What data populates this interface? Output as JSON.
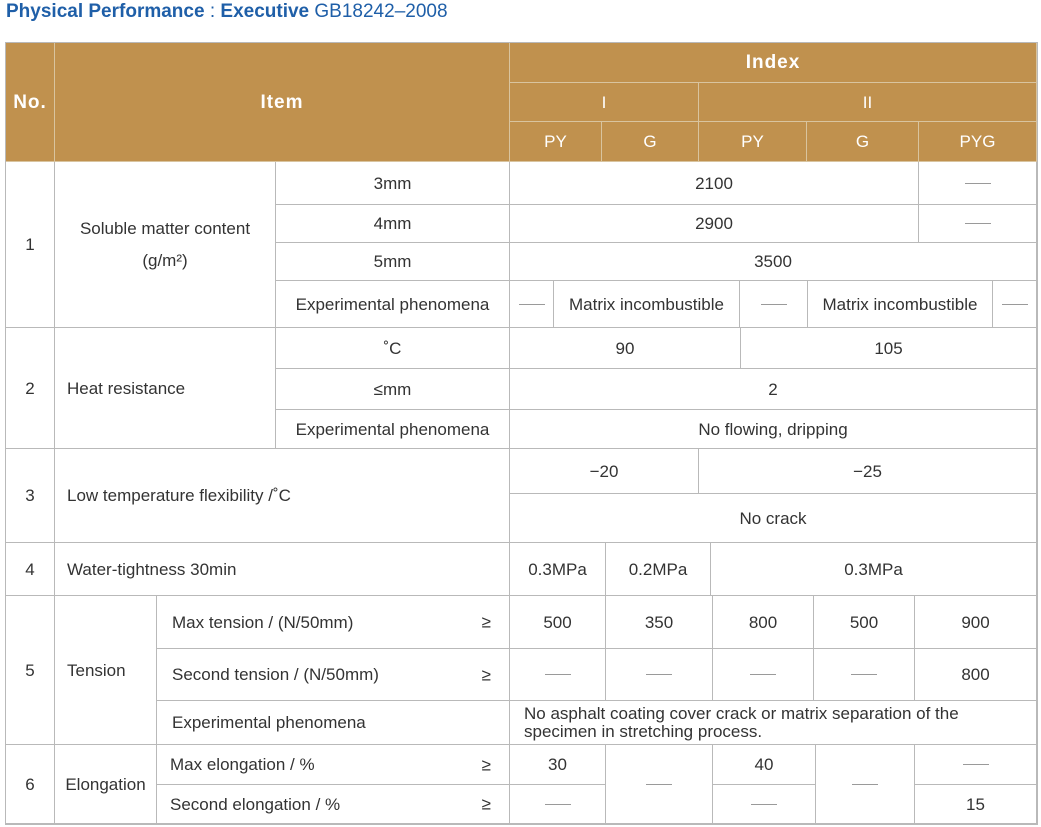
{
  "title": {
    "prefix": "Physical Performance",
    "sep": " : ",
    "executive": "Executive",
    "standard": " GB18242–2008"
  },
  "header": {
    "no": "No.",
    "item": "Item",
    "index": "Index",
    "grade_1": "I",
    "grade_2": "II",
    "py": "PY",
    "g": "G",
    "pyg": "PYG"
  },
  "rows": {
    "r1": {
      "no": "1",
      "item_line1": "Soluble matter content",
      "item_unit": "(g/m²)",
      "sub_3mm": "3mm",
      "sub_4mm": "4mm",
      "sub_5mm": "5mm",
      "sub_phen": "Experimental phenomena",
      "v_3mm": "2100",
      "v_4mm": "2900",
      "v_5mm": "3500",
      "phen_1": "Matrix incombustible",
      "phen_2": "Matrix incombustible"
    },
    "r2": {
      "no": "2",
      "item": "Heat resistance",
      "sub_c": "˚C",
      "sub_mm": "≤mm",
      "sub_phen": "Experimental phenomena",
      "v_c_1": "90",
      "v_c_2": "105",
      "v_mm": "2",
      "v_phen": "No flowing, dripping"
    },
    "r3": {
      "no": "3",
      "item": "Low temperature flexibility /˚C",
      "v_1": "−20",
      "v_2": "−25",
      "v_crack": "No crack"
    },
    "r4": {
      "no": "4",
      "item": "Water-tightness  30min",
      "v_1": "0.3MPa",
      "v_2": "0.2MPa",
      "v_3": "0.3MPa"
    },
    "r5": {
      "no": "5",
      "item": "Tension",
      "sub_max": "Max tension / (N/50mm)",
      "sub_second": "Second tension / (N/50mm)",
      "sub_phen": "Experimental phenomena",
      "ge": "≥",
      "max_vals": [
        "500",
        "350",
        "800",
        "500",
        "900"
      ],
      "second_pyg": "800",
      "phen": "No asphalt coating cover crack or matrix separation of the specimen in stretching process."
    },
    "r6": {
      "no": "6",
      "item": "Elongation",
      "sub_max": "Max elongation  / %",
      "sub_second": "Second elongation  / %",
      "ge": "≥",
      "max_py1": "30",
      "max_py2": "40",
      "second_pyg": "15"
    }
  },
  "colors": {
    "header_bg": "#c0914e",
    "title": "#1f5fa8",
    "grid": "#b9b9b9"
  }
}
